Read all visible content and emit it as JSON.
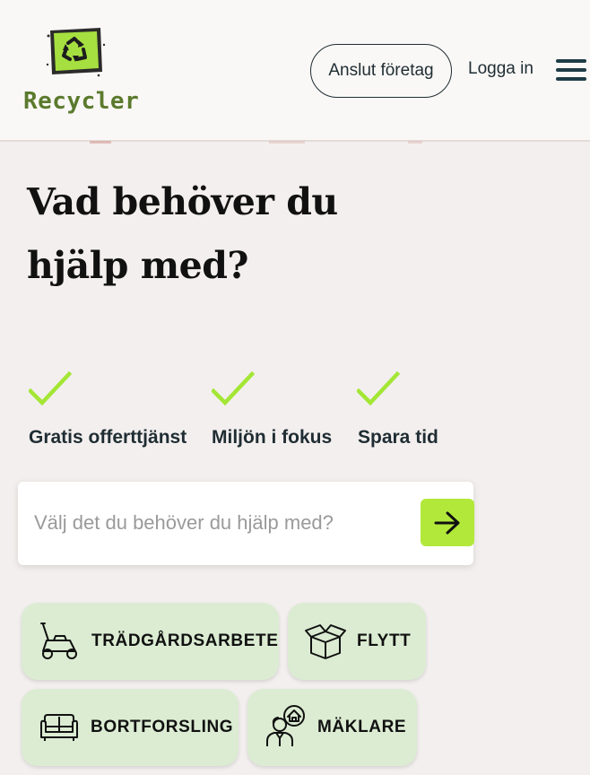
{
  "header": {
    "logo_text": "Recycler",
    "connect_button": "Anslut företag",
    "login_link": "Logga in",
    "menu_icon": "hamburger-menu-icon"
  },
  "hero": {
    "headline_line1": "Vad behöver du",
    "headline_line2": "hjälp med?"
  },
  "features": [
    {
      "label": "Gratis offerttjänst",
      "icon": "check-icon"
    },
    {
      "label": "Miljön i fokus",
      "icon": "check-icon"
    },
    {
      "label": "Spara tid",
      "icon": "check-icon"
    }
  ],
  "search": {
    "placeholder": "Välj det du behöver du hjälp med?",
    "value": "",
    "button_icon": "arrow-right-icon"
  },
  "categories": [
    {
      "label": "TRÄDGÅRDSARBETE",
      "icon": "lawnmower-icon"
    },
    {
      "label": "FLYTT",
      "icon": "box-icon"
    },
    {
      "label": "BORTFORSLING",
      "icon": "sofa-icon"
    },
    {
      "label": "MÄKLARE",
      "icon": "realtor-icon"
    }
  ],
  "colors": {
    "accent_green": "#b2e83a",
    "category_bg": "#dbecd2",
    "page_bg": "#f3efee",
    "logo_green": "#5b7a2d"
  }
}
